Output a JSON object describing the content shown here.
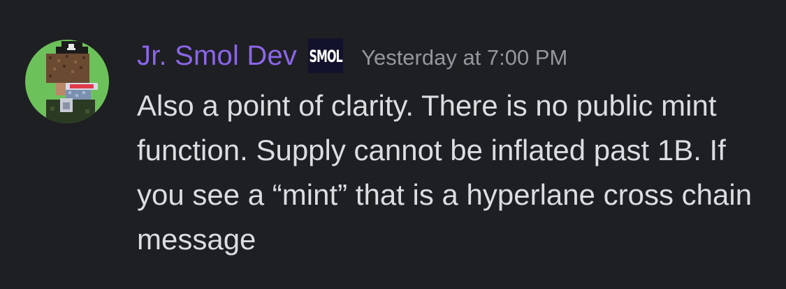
{
  "message": {
    "author": {
      "name": "Jr. Smol Dev",
      "name_color": "#8b66e9",
      "avatar_icon": "pixel-pirate-avatar",
      "role_badge": "SMOL"
    },
    "timestamp": "Yesterday at 7:00 PM",
    "body": "Also a point of clarity. There is no public mint function. Supply cannot be inflated past 1B. If you see a “mint” that is a hyperlane cross chain message"
  },
  "colors": {
    "background": "#1e1f22",
    "text": "#dbdde1",
    "timestamp": "#94979e"
  }
}
